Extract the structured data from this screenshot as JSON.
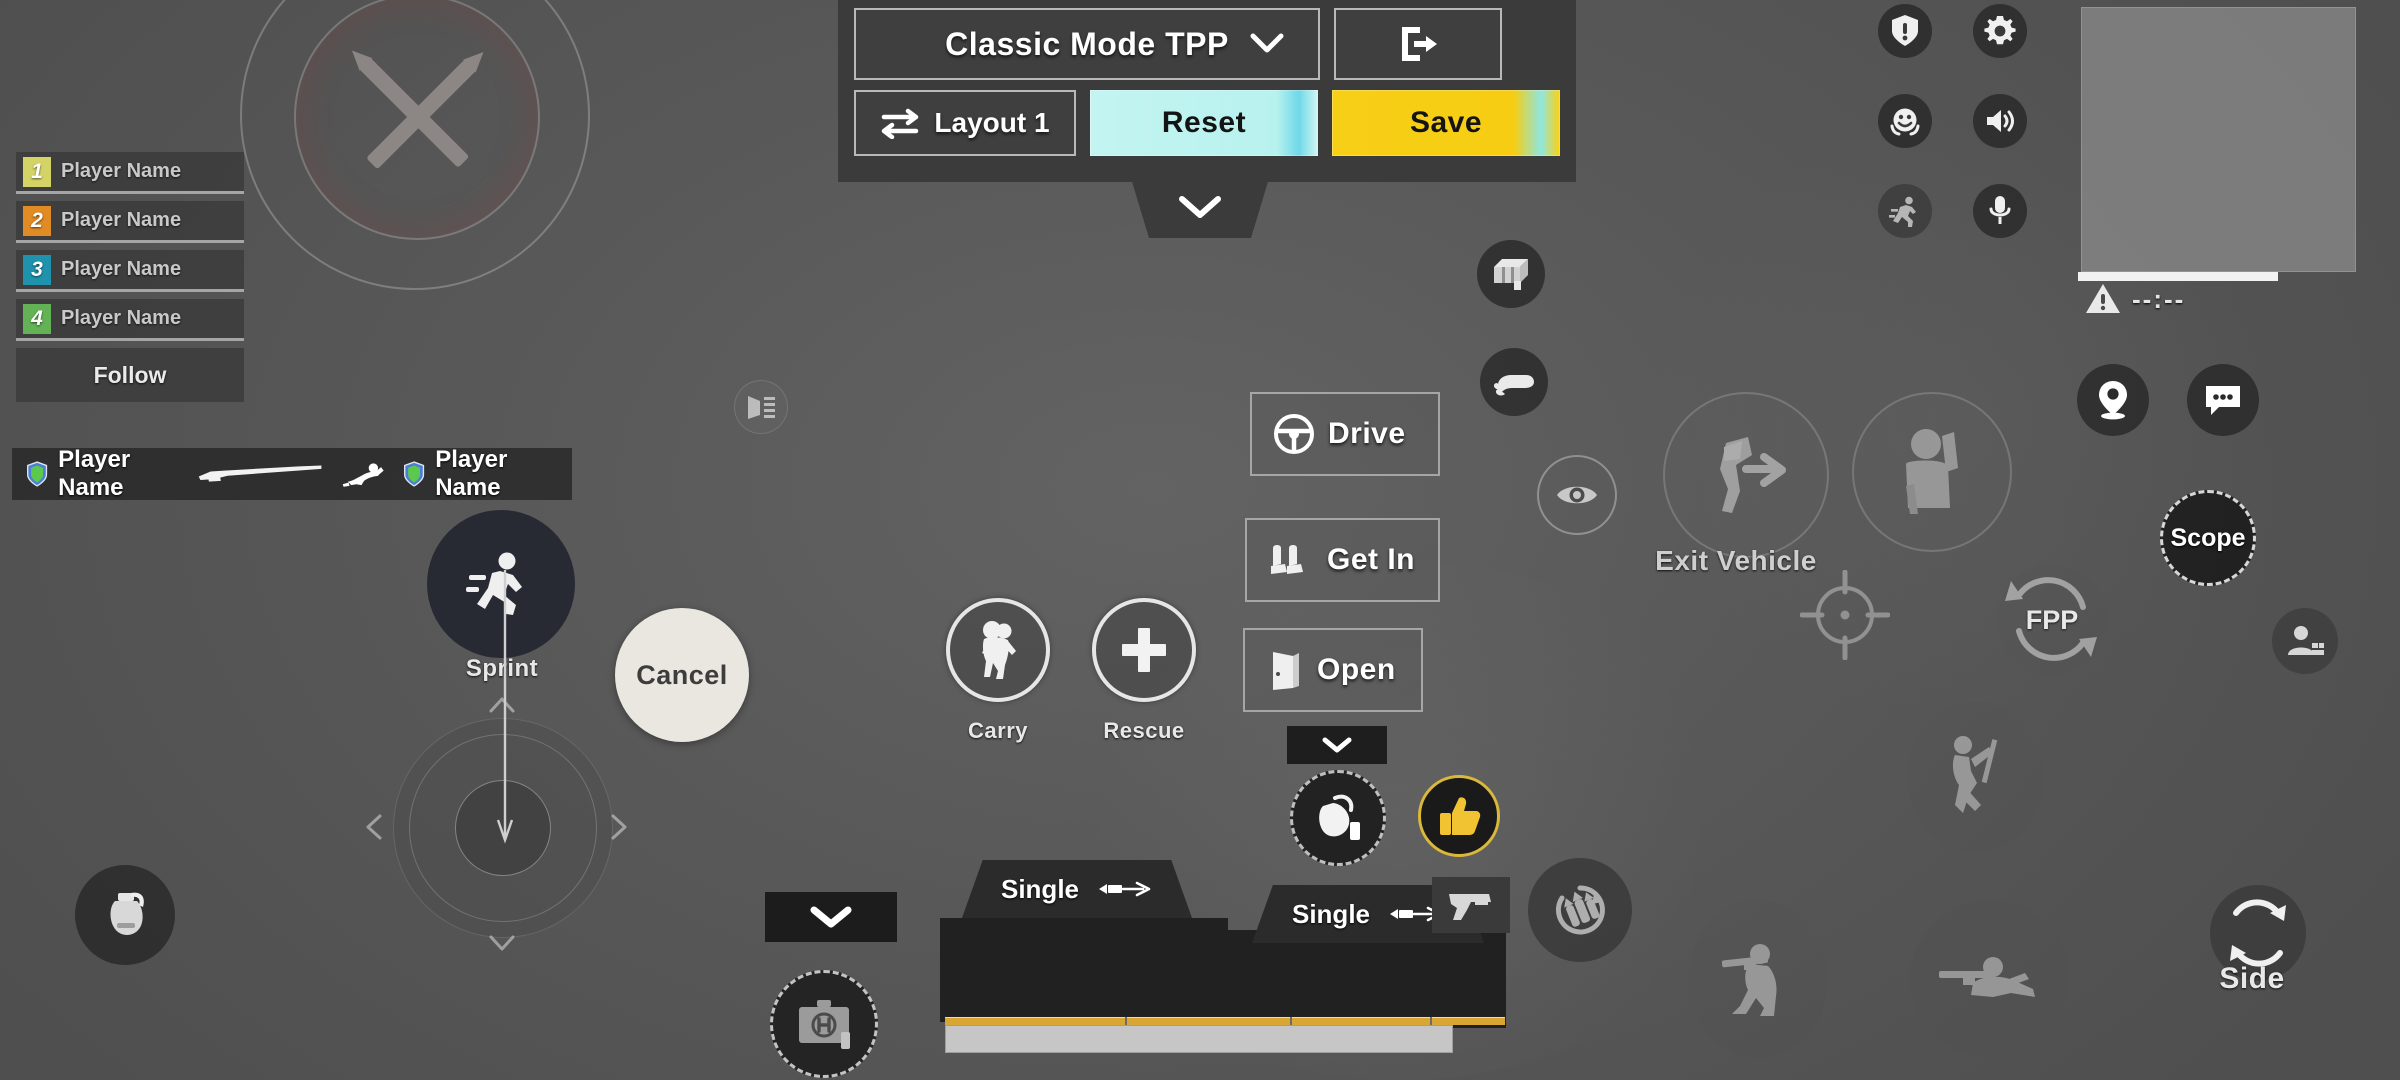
{
  "editor": {
    "mode_label": "Classic Mode TPP",
    "mode_dropdown_icon": "chevron-down-icon",
    "exit_icon": "exit-door-icon",
    "layout_label": "Layout 1",
    "layout_icon": "swap-arrows-icon",
    "reset_label": "Reset",
    "save_label": "Save",
    "collapse_icon": "chevron-down-icon",
    "colors": {
      "panel_bg": "#3b3b3b",
      "reset_bg": "#b8f2ef",
      "save_bg": "#f7cf16",
      "border": "#b9b9b9"
    }
  },
  "team": {
    "rows": [
      {
        "num": "1",
        "name": "Player Name",
        "color": "#d4d466"
      },
      {
        "num": "2",
        "name": "Player Name",
        "color": "#e08b24"
      },
      {
        "num": "3",
        "name": "Player Name",
        "color": "#1f93ad"
      },
      {
        "num": "4",
        "name": "Player Name",
        "color": "#63b356"
      }
    ],
    "follow_label": "Follow"
  },
  "killfeed": {
    "killer_name": "Player Name",
    "victim_name": "Player Name",
    "weapon_icon": "rifle-icon",
    "death_icon": "knocked-player-icon",
    "badge_icon": "clan-shield-icon"
  },
  "actions": {
    "drive": {
      "label": "Drive",
      "icon": "steering-wheel-icon"
    },
    "get_in": {
      "label": "Get In",
      "icon": "car-seats-icon"
    },
    "open": {
      "label": "Open",
      "icon": "door-icon"
    },
    "carry": {
      "label": "Carry",
      "icon": "carry-player-icon"
    },
    "rescue": {
      "label": "Rescue",
      "icon": "plus-icon"
    },
    "exit_vehicle": {
      "label": "Exit Vehicle",
      "icon": "exit-vehicle-icon"
    },
    "peek": {
      "label": "",
      "icon": "peek-player-icon"
    },
    "scope": {
      "label": "Scope",
      "icon": "scope-ring-icon"
    },
    "fpp": {
      "label": "FPP",
      "icon": "camera-rotate-icon"
    },
    "side": {
      "label": "Side",
      "icon": "rotate-arrows-icon"
    },
    "sprint": {
      "label": "Sprint",
      "icon": "running-man-icon"
    },
    "cancel": {
      "label": "Cancel"
    },
    "collapse_left": {
      "icon": "chevron-down-icon"
    },
    "collapse_right": {
      "icon": "chevron-down-icon"
    }
  },
  "weapons": {
    "slot1": {
      "fire_mode": "Single",
      "fire_icon": "bullet-arrow-icon"
    },
    "slot2": {
      "fire_mode": "Single",
      "fire_icon": "bullet-arrow-icon"
    },
    "pistol_icon": "pistol-icon",
    "reload_icon": "reload-bullets-icon",
    "throwable_icon": "grenade-pin-icon",
    "medkit_icon": "medkit-h-icon",
    "thumbs_up_icon": "thumbs-up-icon",
    "grenade_icon": "frag-grenade-icon"
  },
  "topbar": {
    "icons": [
      {
        "name": "report-shield-icon",
        "row": 1,
        "col": 1
      },
      {
        "name": "gear-icon",
        "row": 1,
        "col": 2
      },
      {
        "name": "emote-smiley-icon",
        "row": 2,
        "col": 1
      },
      {
        "name": "speaker-volume-icon",
        "row": 2,
        "col": 2
      },
      {
        "name": "sprint-runner-icon",
        "row": 3,
        "col": 1
      },
      {
        "name": "microphone-icon",
        "row": 3,
        "col": 2
      }
    ]
  },
  "minimap": {
    "timer": "--:--",
    "warning_icon": "warning-triangle-icon",
    "compass_bar": true
  },
  "right_icons": {
    "marker": {
      "icon": "map-marker-icon"
    },
    "chat": {
      "icon": "chat-bubble-icon"
    },
    "spectate": {
      "icon": "person-card-icon"
    }
  },
  "hud": {
    "ammo_reticle_icon": "crossed-bullets-icon",
    "crosshair_icon": "crosshair-icon",
    "eye_icon": "eye-peek-icon",
    "supply_icon": "supply-crate-icon",
    "pickup_icon": "pickup-hand-icon",
    "door_side_icon": "door-open-side-icon",
    "joystick_icon": "movement-joystick",
    "stance_crouch_icon": "crouch-icon",
    "stance_prone_icon": "prone-icon",
    "stance_jump_icon": "vault-jump-icon",
    "stance_climb_icon": "climb-icon"
  }
}
